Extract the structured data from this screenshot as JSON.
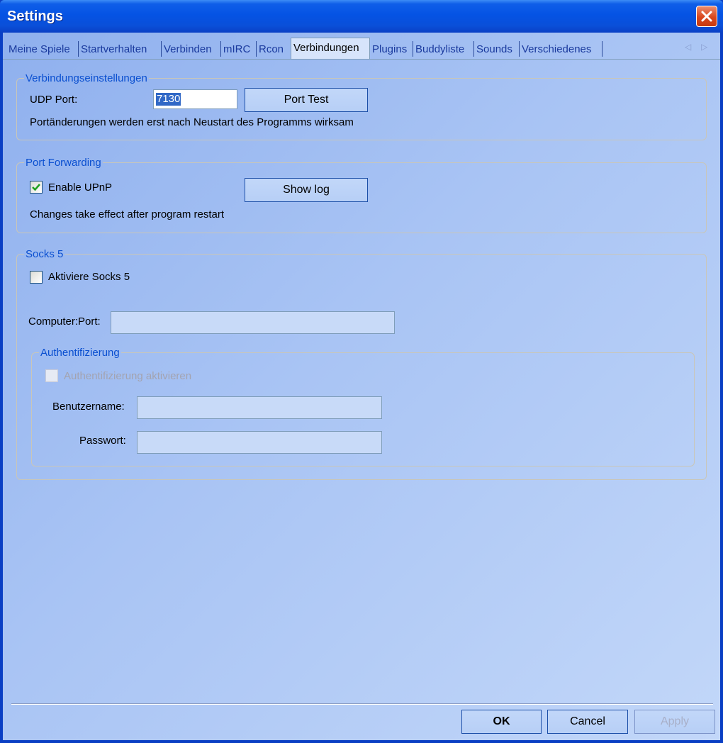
{
  "window": {
    "title": "Settings"
  },
  "tabs": [
    {
      "label": "Meine Spiele"
    },
    {
      "label": "Startverhalten"
    },
    {
      "label": "Verbinden"
    },
    {
      "label": "mIRC"
    },
    {
      "label": "Rcon"
    },
    {
      "label": "Verbindungen",
      "active": true
    },
    {
      "label": "Plugins"
    },
    {
      "label": "Buddyliste"
    },
    {
      "label": "Sounds"
    },
    {
      "label": "Verschiedenes"
    }
  ],
  "connection_settings": {
    "legend": "Verbindungseinstellungen",
    "udp_port_label": "UDP Port:",
    "udp_port_value": "7130",
    "port_test_button": "Port Test",
    "note": "Portänderungen werden erst nach Neustart des Programms wirksam"
  },
  "port_forwarding": {
    "legend": "Port Forwarding",
    "enable_upnp_label": "Enable UPnP",
    "enable_upnp_checked": true,
    "show_log_button": "Show log",
    "note": "Changes take effect after program restart"
  },
  "socks5": {
    "legend": "Socks 5",
    "enable_label": "Aktiviere Socks 5",
    "enable_checked": false,
    "computer_port_label": "Computer:Port:",
    "computer_port_value": "",
    "auth": {
      "legend": "Authentifizierung",
      "enable_label": "Authentifizierung aktivieren",
      "enable_checked": false,
      "username_label": "Benutzername:",
      "username_value": "",
      "password_label": "Passwort:",
      "password_value": ""
    }
  },
  "footer": {
    "ok_button": "OK",
    "cancel_button": "Cancel",
    "apply_button": "Apply"
  },
  "colors": {
    "title_bar": "#0553e4",
    "legend_text": "#0a4fd0",
    "close_button": "#d9471d"
  }
}
